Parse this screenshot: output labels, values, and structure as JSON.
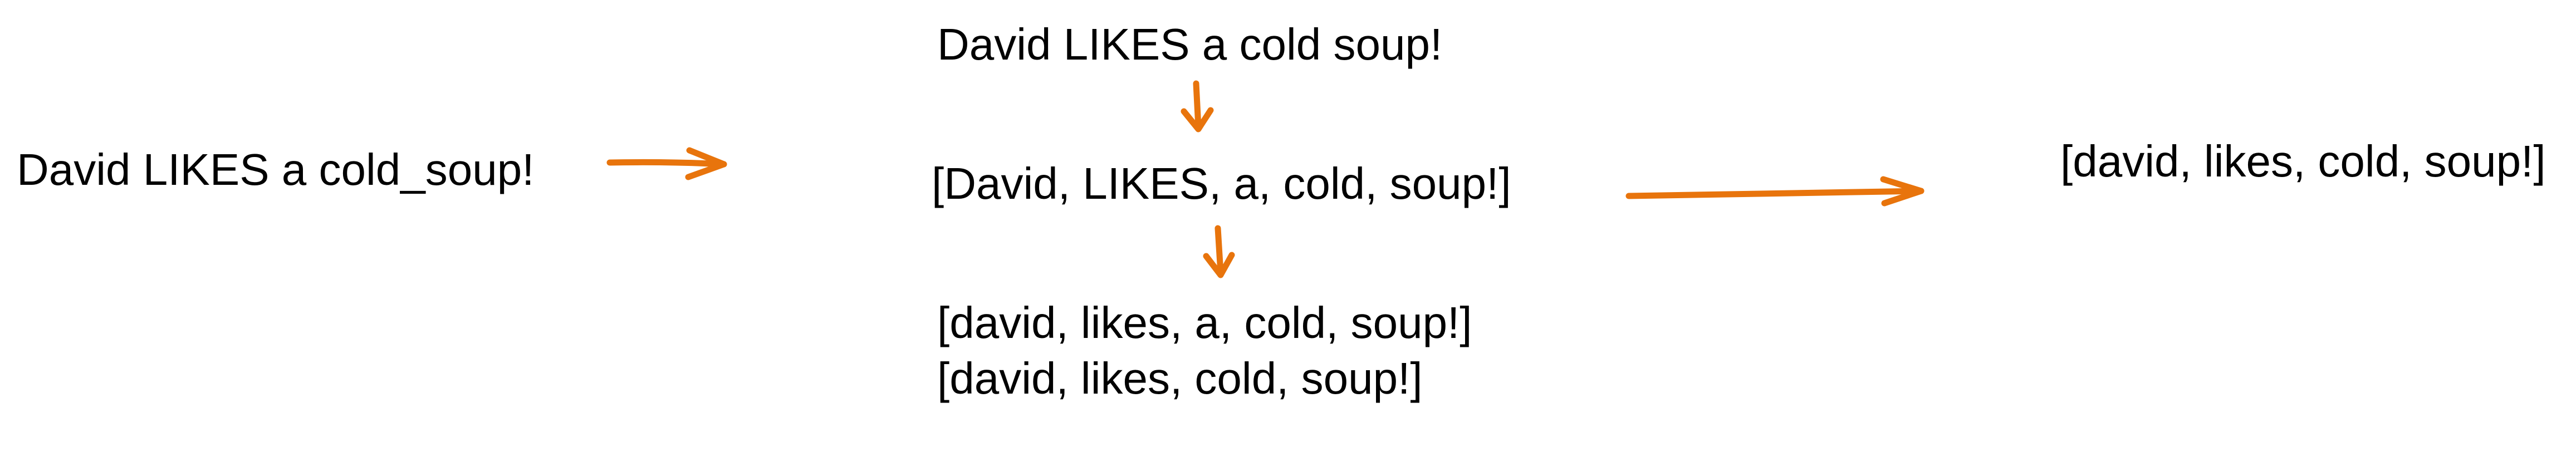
{
  "diagram": {
    "input": "David LIKES a cold_soup!",
    "step_1": "David LIKES a cold soup!",
    "step_2": "[David, LIKES, a, cold, soup!]",
    "step_3": "[david, likes, a, cold, soup!]",
    "step_4": "[david, likes, cold, soup!]",
    "output": "[david, likes, cold, soup!]"
  },
  "colors": {
    "arrow": "#E8740C",
    "text": "#000000",
    "background": "#ffffff"
  }
}
